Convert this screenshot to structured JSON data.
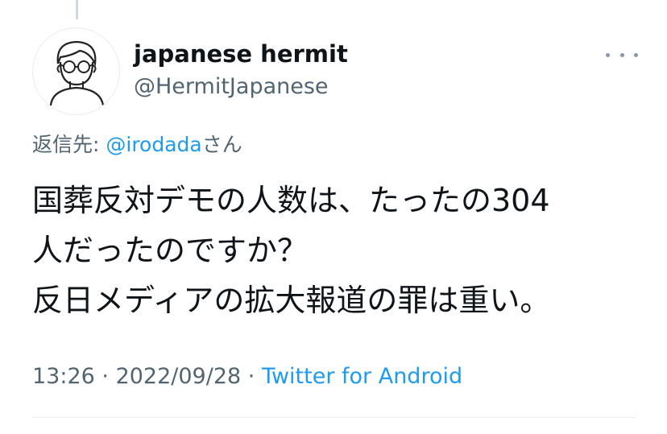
{
  "tweet": {
    "author": {
      "display_name": "japanese hermit",
      "handle": "@HermitJapanese",
      "avatar_icon": "person-with-glasses-icon"
    },
    "reply_to": {
      "prefix": "返信先: ",
      "mention": "@irodada",
      "suffix": "さん"
    },
    "text_lines": [
      "国葬反対デモの人数は、たったの304",
      "人だったのですか？",
      "反日メディアの拡大報道の罪は重い。"
    ],
    "meta": {
      "time": "13:26",
      "separator": " · ",
      "date": "2022/09/28",
      "source": "Twitter for Android"
    }
  },
  "colors": {
    "link": "#1d9bf0",
    "secondary_text": "#536471",
    "primary_text": "#0f1419"
  }
}
